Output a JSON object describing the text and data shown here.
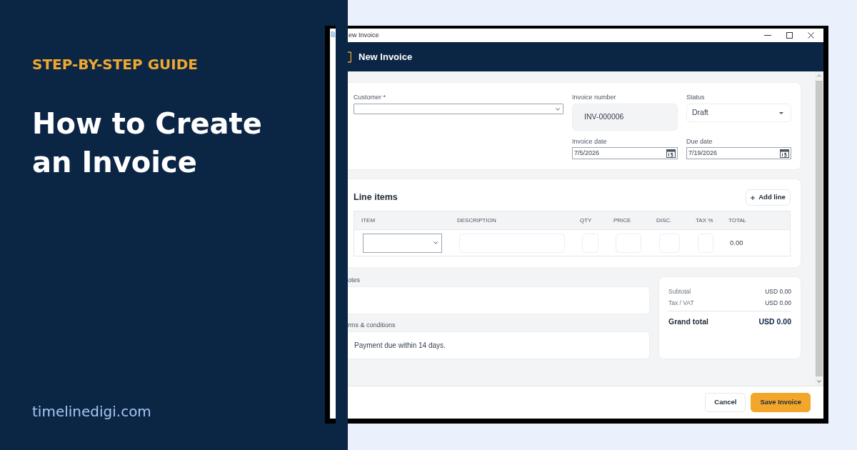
{
  "guide": {
    "eyebrow": "STEP-BY-STEP GUIDE",
    "title_lines": [
      "How to Create",
      "an Invoice"
    ],
    "site": "timelinedigi.com"
  },
  "window": {
    "title": "ew Invoice",
    "header": "New Invoice"
  },
  "details": {
    "customer": {
      "label": "Customer *"
    },
    "invoice_number": {
      "label": "Invoice number",
      "value": "INV-000006"
    },
    "status": {
      "label": "Status",
      "value": "Draft"
    },
    "invoice_date": {
      "label": "Invoice date",
      "value": "7/5/2026"
    },
    "due_date": {
      "label": "Due date",
      "value": "7/19/2026"
    }
  },
  "line_items": {
    "title": "Line items",
    "add_button": "Add line",
    "columns": [
      "ITEM",
      "DESCRIPTION",
      "QTY",
      "PRICE",
      "DISC.",
      "TAX %",
      "TOTAL"
    ],
    "rows": [
      {
        "total": "0.00"
      }
    ]
  },
  "notes": {
    "label": "otes"
  },
  "terms": {
    "label": "rms & conditions",
    "value": "Payment due within 14 days."
  },
  "totals": {
    "rows": [
      {
        "label": "Subtotal",
        "value": "USD 0.00"
      },
      {
        "label": "Tax / VAT",
        "value": "USD 0.00"
      }
    ],
    "grand_total": {
      "label": "Grand total",
      "value": "USD 0.00"
    }
  },
  "buttons": [
    {
      "label": "Cancel",
      "kind": "secondary"
    },
    {
      "label": "Save Invoice",
      "kind": "primary"
    }
  ]
}
